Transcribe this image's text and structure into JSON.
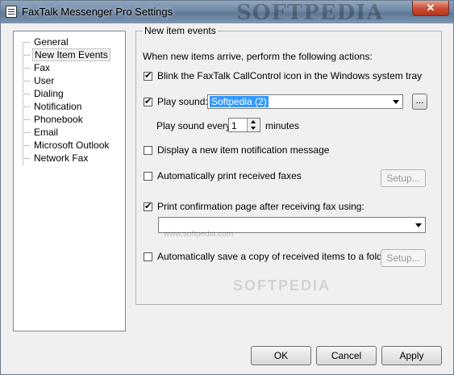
{
  "window": {
    "title": "FaxTalk Messenger Pro Settings",
    "watermark": "SOFTPEDIA",
    "close_glyph": "✕"
  },
  "tree": {
    "items": [
      {
        "label": "General"
      },
      {
        "label": "New Item Events",
        "selected": true
      },
      {
        "label": "Fax"
      },
      {
        "label": "User"
      },
      {
        "label": "Dialing"
      },
      {
        "label": "Notification"
      },
      {
        "label": "Phonebook"
      },
      {
        "label": "Email"
      },
      {
        "label": "Microsoft Outlook"
      },
      {
        "label": "Network Fax"
      }
    ]
  },
  "panel": {
    "legend": "New item events",
    "intro": "When new items arrive, perform the following actions:",
    "blink": {
      "label": "Blink the FaxTalk CallControl icon in the Windows system tray",
      "checked": true
    },
    "play_sound": {
      "label": "Play sound:",
      "checked": true,
      "value": "Softpedia (2)",
      "browse_label": "..."
    },
    "play_every": {
      "prefix": "Play sound every",
      "value": "1",
      "suffix": "minutes"
    },
    "display_msg": {
      "label": "Display a new item notification message",
      "checked": false
    },
    "auto_print": {
      "label": "Automatically print received faxes",
      "checked": false,
      "setup_label": "Setup..."
    },
    "confirm_page": {
      "label": "Print confirmation page after receiving fax using:",
      "checked": true,
      "value": ""
    },
    "auto_save": {
      "label": "Automatically save a copy of received items to a folder",
      "checked": false,
      "setup_label": "Setup..."
    },
    "site_watermark": "www.softpedia.com",
    "center_watermark": "SOFTPEDIA"
  },
  "buttons": {
    "ok": "OK",
    "cancel": "Cancel",
    "apply": "Apply"
  },
  "colors": {
    "selection": "#3399ff",
    "close": "#c9513b"
  }
}
